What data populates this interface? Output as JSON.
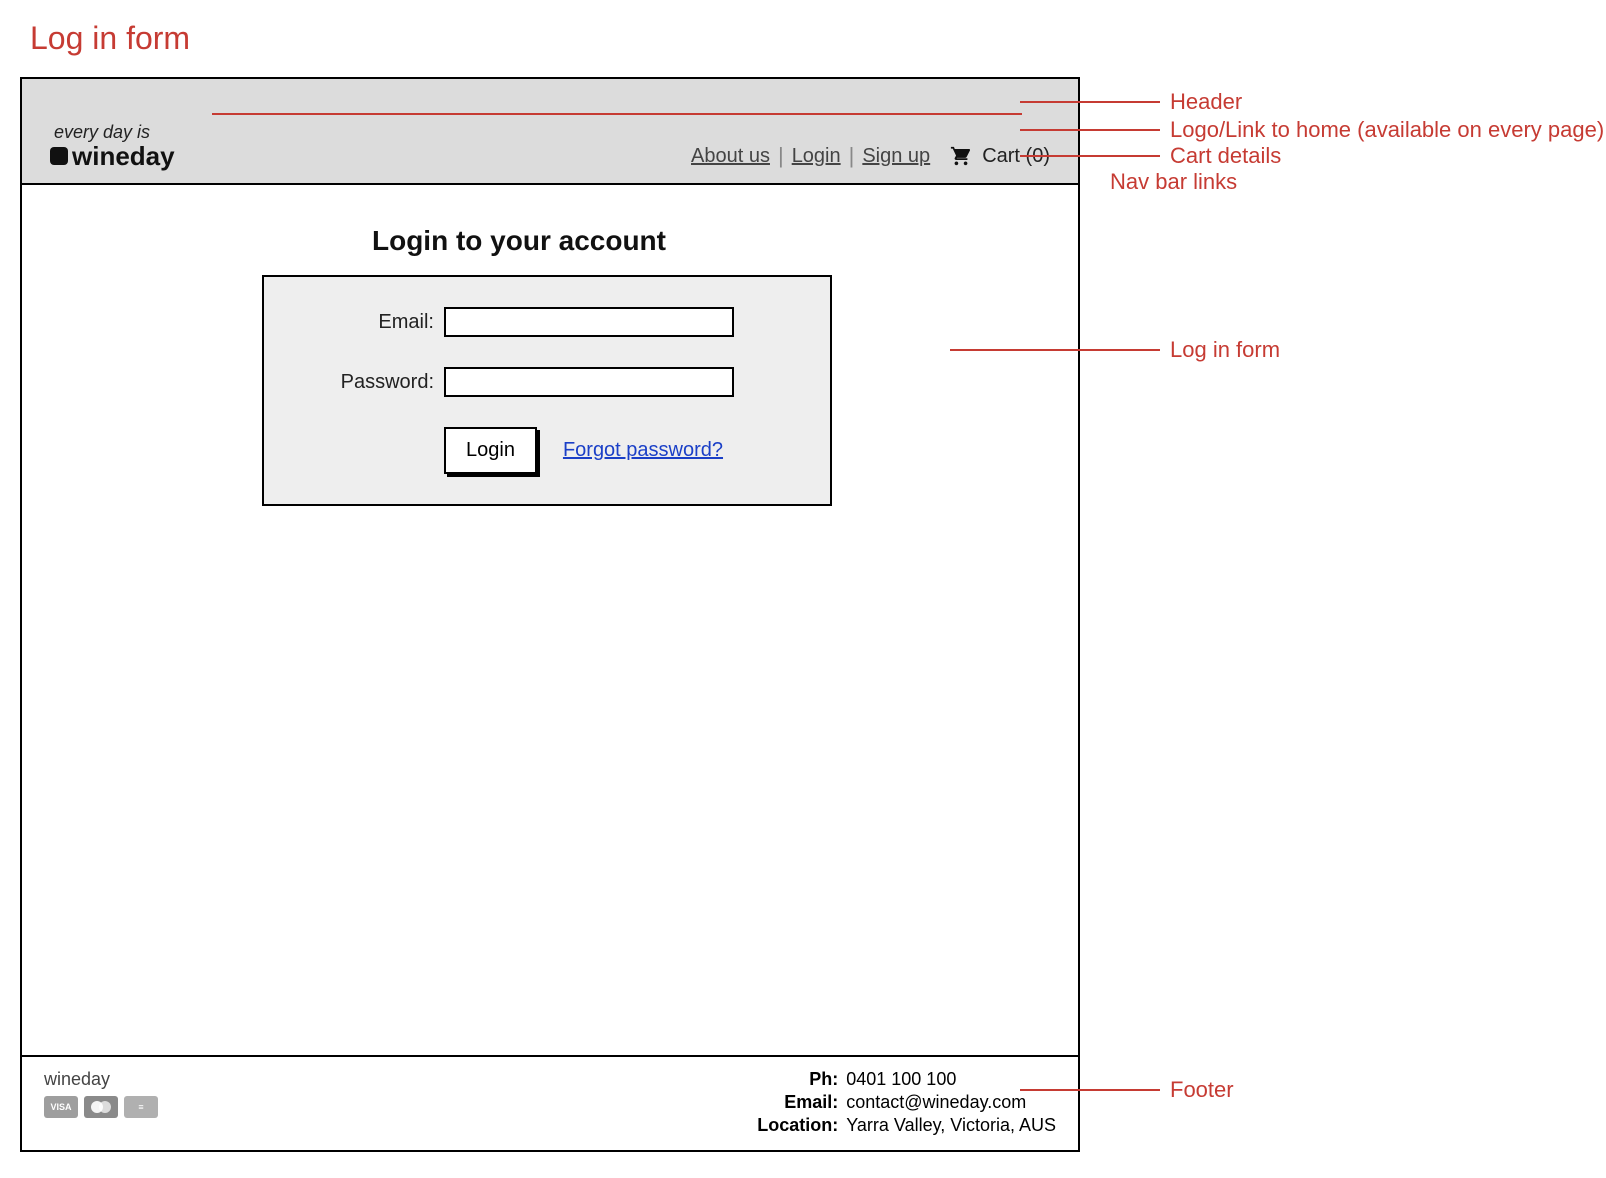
{
  "page": {
    "title": "Log in form"
  },
  "header": {
    "logo": {
      "tagline": "every day is",
      "brand": "wineday"
    },
    "nav": {
      "about": "About us",
      "login": "Login",
      "signup": "Sign up"
    },
    "cart": {
      "label": "Cart",
      "count": "(0)"
    }
  },
  "main": {
    "heading": "Login to your account",
    "form": {
      "email_label": "Email:",
      "password_label": "Password:",
      "submit_label": "Login",
      "forgot_label": "Forgot password?"
    }
  },
  "footer": {
    "brand": "wineday",
    "cards": {
      "visa": "VISA",
      "mc": "mc",
      "amex": "AMEX"
    },
    "contact": {
      "ph_label": "Ph:",
      "ph_value": "0401 100 100",
      "email_label": "Email:",
      "email_value": "contact@wineday.com",
      "location_label": "Location:",
      "location_value": "Yarra Valley, Victoria, AUS"
    }
  },
  "annotations": {
    "header": "Header",
    "logo": "Logo/Link to home (available on every page)",
    "cart": "Cart details",
    "nav": "Nav bar links",
    "form": "Log in form",
    "footer": "Footer"
  }
}
